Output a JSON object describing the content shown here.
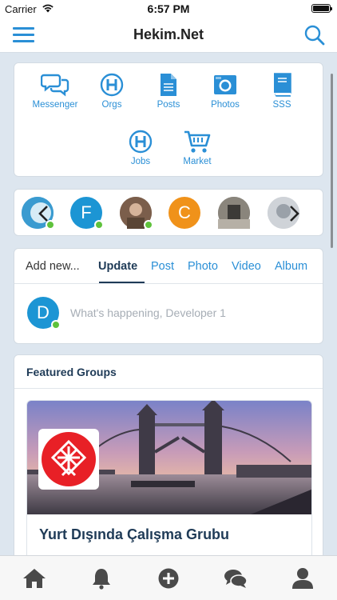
{
  "status_bar": {
    "carrier": "Carrier",
    "time": "6:57 PM"
  },
  "nav": {
    "title": "Hekim.Net",
    "menu_icon": "hamburger-menu-icon",
    "search_icon": "search-icon"
  },
  "colors": {
    "accent": "#2a8fd6",
    "dark_title": "#1f3b57",
    "online": "#5fc23c",
    "background": "#dde6ef"
  },
  "apps": [
    {
      "label": "Messenger",
      "icon": "chat-bubbles-icon"
    },
    {
      "label": "Orgs",
      "icon": "h-circle-icon"
    },
    {
      "label": "Posts",
      "icon": "document-icon"
    },
    {
      "label": "Photos",
      "icon": "camera-icon"
    },
    {
      "label": "SSS",
      "icon": "book-icon"
    },
    {
      "label": "Jobs",
      "icon": "h-circle-icon"
    },
    {
      "label": "Market",
      "icon": "cart-icon"
    }
  ],
  "stories": [
    {
      "letter": "",
      "color": "#3a9bd0",
      "online": true
    },
    {
      "letter": "F",
      "color": "#1c95d4",
      "online": true
    },
    {
      "letter": "",
      "color": "#8a6a55",
      "online": true
    },
    {
      "letter": "C",
      "color": "#f0921a",
      "online": false
    },
    {
      "letter": "",
      "color": "#6f6a62",
      "online": false
    },
    {
      "letter": "",
      "color": "#c8cdd3",
      "online": false
    }
  ],
  "composer": {
    "tabs": [
      "Add new...",
      "Update",
      "Post",
      "Photo",
      "Video",
      "Album"
    ],
    "active_tab": "Update",
    "avatar_letter": "D",
    "placeholder": "What's happening, Developer 1"
  },
  "featured_groups": {
    "title": "Featured Groups",
    "items": [
      {
        "name": "Yurt Dışında Çalışma Grubu"
      }
    ]
  },
  "tabbar": [
    {
      "icon": "home-icon"
    },
    {
      "icon": "bell-icon"
    },
    {
      "icon": "plus-circle-icon"
    },
    {
      "icon": "chat-icon"
    },
    {
      "icon": "profile-icon"
    }
  ]
}
